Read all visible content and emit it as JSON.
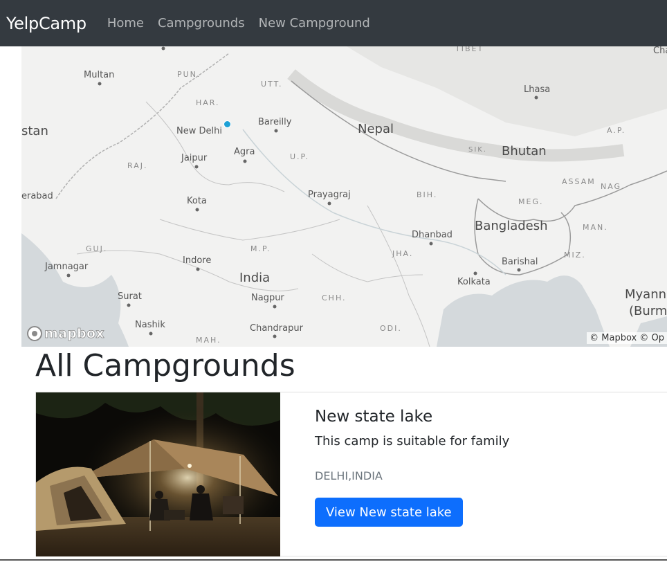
{
  "navbar": {
    "brand": "YelpCamp",
    "links": [
      "Home",
      "Campgrounds",
      "New Campground"
    ]
  },
  "map": {
    "attribution": "© Mapbox © Op",
    "logo_text": "mapbox",
    "countries": [
      "Nepal",
      "Bhutan",
      "Bangladesh",
      "India",
      "Myann",
      "(Burm",
      "stan"
    ],
    "states": [
      "PUN.",
      "HAR.",
      "UTT.",
      "RAJ.",
      "U.P.",
      "BIH.",
      "GUJ.",
      "M.P.",
      "JHA.",
      "CHH.",
      "ODI.",
      "MAH.",
      "SIK.",
      "MEG.",
      "ASSAM",
      "NAG.",
      "A.P.",
      "MAN.",
      "MIZ.",
      "TIBET"
    ],
    "cities": [
      "Multan",
      "New Delhi",
      "Bareilly",
      "Agra",
      "Jaipur",
      "Kota",
      "Prayagraj",
      "Indore",
      "Jamnagar",
      "Surat",
      "Nashik",
      "Nagpur",
      "Chandrapur",
      "Dhanbad",
      "Kolkata",
      "Barishal",
      "Lhasa",
      "erabad",
      "Cha"
    ],
    "marker_color": "#1da1d6"
  },
  "page": {
    "title": "All Campgrounds"
  },
  "campgrounds": [
    {
      "title": "New state lake",
      "description": "This camp is suitable for family",
      "location": "DELHI,INDIA",
      "button_label": "View New state lake"
    }
  ],
  "colors": {
    "navbar_bg": "#343a40",
    "primary_button": "#0d6efd",
    "muted_text": "#6c757d"
  }
}
